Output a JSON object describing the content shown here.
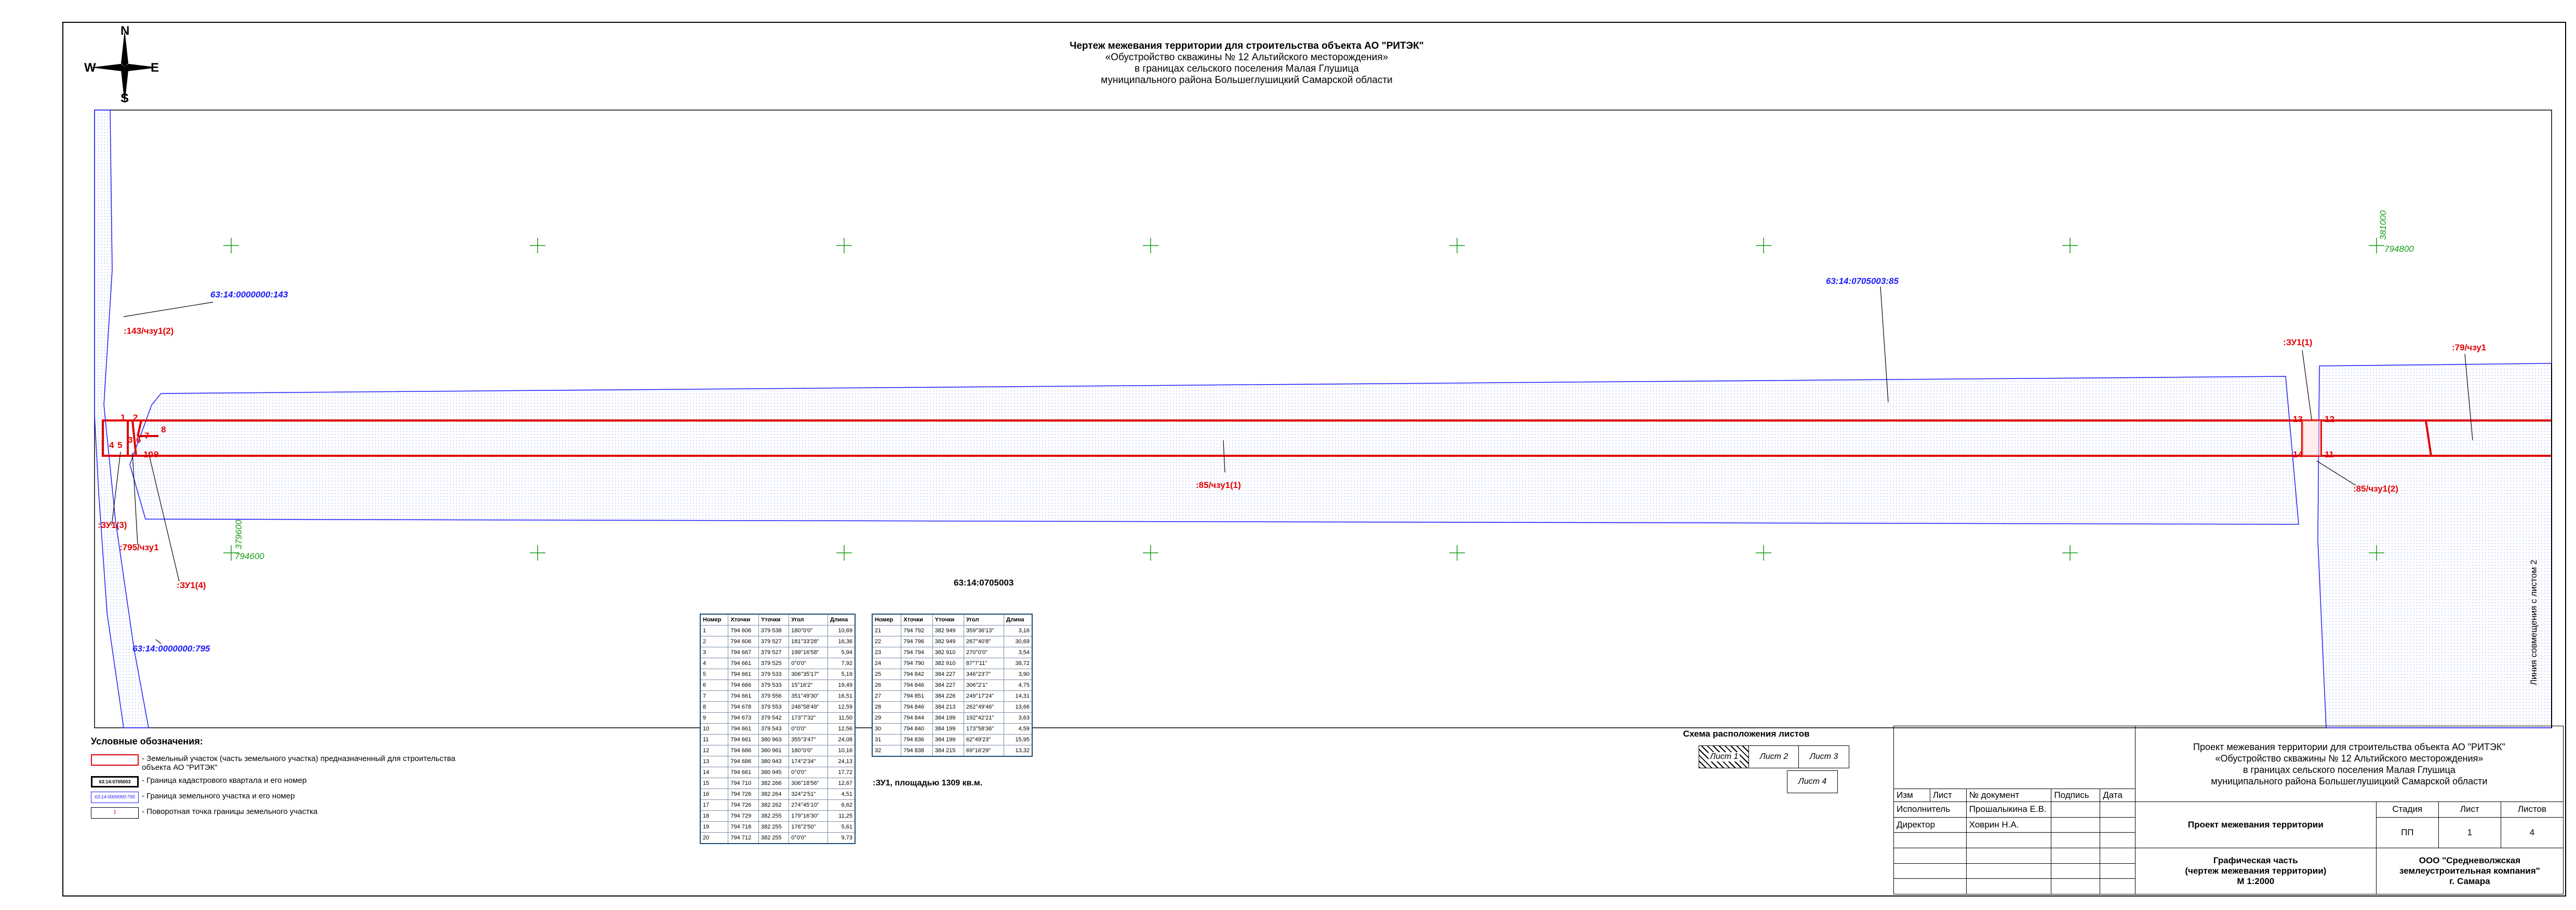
{
  "title": {
    "line1": "Чертеж межевания территории для строительства объекта АО \"РИТЭК\"",
    "line2": "«Обустройство скважины № 12 Альтийского месторождения»",
    "line3": "в границах сельского поселения Малая Глушица",
    "line4": "муниципального района Большеглушицкий Самарской области"
  },
  "compass": {
    "n": "N",
    "s": "S",
    "w": "W",
    "e": "E"
  },
  "map_labels": {
    "cad143": "63:14:0000000:143",
    "cad795": "63:14:0000000:795",
    "cad85": "63:14:0705003:85",
    "quarter": "63:14:0705003",
    "part143": ":143/чзу1(2)",
    "part795": ":795/чзу1",
    "zu1_1": ":ЗУ1(1)",
    "zu1_3": ":ЗУ1(3)",
    "zu1_4": ":ЗУ1(4)",
    "part85_1": ":85/чзу1(1)",
    "part85_2": ":85/чзу1(2)",
    "part79": ":79/чзу1",
    "grid_x1": "381000",
    "grid_y1": "794800",
    "grid_x2": "379600",
    "grid_y2": "794600",
    "combine_line": "Линия совмещения с листом 2",
    "area_note": ":ЗУ1, площадью 1309 кв.м."
  },
  "nodes": [
    "1",
    "2",
    "3",
    "4",
    "5",
    "6",
    "7",
    "8",
    "9",
    "10",
    "12",
    "13",
    "14",
    "11"
  ],
  "coord_table_headers": [
    "Номер",
    "Xточки",
    "Yточки",
    "Угол",
    "Длина"
  ],
  "coord_table_1": [
    [
      "1",
      "794 606",
      "379 538",
      "180°0'0\"",
      "10,69"
    ],
    [
      "2",
      "794 606",
      "379 527",
      "181°33'28\"",
      "16,36"
    ],
    [
      "3",
      "794 667",
      "379 527",
      "199°16'58\"",
      "5,94"
    ],
    [
      "4",
      "794 661",
      "379 525",
      "0°0'0\"",
      "7,92"
    ],
    [
      "5",
      "794 661",
      "379 533",
      "306°35'17\"",
      "5,19"
    ],
    [
      "6",
      "794 666",
      "379 533",
      "15°16'2\"",
      "19,49"
    ],
    [
      "7",
      "794 661",
      "379 556",
      "351°49'30\"",
      "16,51"
    ],
    [
      "8",
      "794 678",
      "379 553",
      "246°58'49\"",
      "12,59"
    ],
    [
      "9",
      "794 673",
      "379 542",
      "173°7'32\"",
      "11,50"
    ],
    [
      "10",
      "794 661",
      "379 543",
      "0°0'0\"",
      "12,56"
    ],
    [
      "11",
      "794 661",
      "380 963",
      "355°3'47\"",
      "24,08"
    ],
    [
      "12",
      "794 686",
      "380 961",
      "180°0'0\"",
      "10,16"
    ],
    [
      "13",
      "794 686",
      "380 943",
      "174°2'34\"",
      "24,13"
    ],
    [
      "14",
      "794 661",
      "380 945",
      "0°0'0\"",
      "17,72"
    ],
    [
      "15",
      "794 710",
      "382 266",
      "306°18'56\"",
      "12,67"
    ],
    [
      "16",
      "794 726",
      "382 264",
      "324°2'51\"",
      "4,51"
    ],
    [
      "17",
      "794 726",
      "382 262",
      "274°45'10\"",
      "6,62"
    ],
    [
      "18",
      "794 729",
      "382 255",
      "179°16'30\"",
      "11,25"
    ],
    [
      "19",
      "794 718",
      "382 255",
      "176°2'50\"",
      "5,61"
    ],
    [
      "20",
      "794 712",
      "382 255",
      "0°0'0\"",
      "9,73"
    ]
  ],
  "coord_table_2": [
    [
      "21",
      "794 792",
      "382 949",
      "359°36'13\"",
      "3,16"
    ],
    [
      "22",
      "794 796",
      "382 949",
      "267°40'8\"",
      "30,69"
    ],
    [
      "23",
      "794 794",
      "382 910",
      "270°0'0\"",
      "3,54"
    ],
    [
      "24",
      "794 790",
      "382 910",
      "87°7'11\"",
      "38,72"
    ],
    [
      "25",
      "794 842",
      "384 227",
      "346°23'7\"",
      "3,90"
    ],
    [
      "26",
      "794 846",
      "384 227",
      "306°2'1\"",
      "4,75"
    ],
    [
      "27",
      "794 851",
      "384 226",
      "249°17'24\"",
      "14,31"
    ],
    [
      "28",
      "794 846",
      "384 213",
      "262°49'46\"",
      "13,66"
    ],
    [
      "29",
      "794 844",
      "384 199",
      "192°42'21\"",
      "3,63"
    ],
    [
      "30",
      "794 840",
      "384 199",
      "173°58'36\"",
      "4,59"
    ],
    [
      "31",
      "794 836",
      "384 199",
      "62°49'23\"",
      "15,95"
    ],
    [
      "32",
      "794 838",
      "384 215",
      "69°16'29\"",
      "13,32"
    ]
  ],
  "legend": {
    "heading": "Условные обозначения:",
    "item1": "- Земельный участок (часть земельного участка) предназначенный для строительства объекта АО \"РИТЭК\"",
    "item2": "- Граница кадастрового квартала и его номер",
    "item3": "- Граница земельного участка и его номер",
    "item4": "- Поворотная точка границы земельного участка",
    "sym2_text": "63:14:0705003",
    "sym3_text": "63:14:0000000:795",
    "sym4_text": "1"
  },
  "sheet_scheme": {
    "title": "Схема расположения листов",
    "s1": "Лист 1",
    "s2": "Лист 2",
    "s3": "Лист 3",
    "s4": "Лист 4"
  },
  "stamp": {
    "h_izm": "Изм",
    "h_list": "Лист",
    "h_doc": "№ документ",
    "h_sign": "Подпись",
    "h_date": "Дата",
    "role1": "Исполнитель",
    "name1": "Прошалыкина Е.В.",
    "role2": "Директор",
    "name2": "Ховрин Н.А.",
    "project1": "Проект межевания территории для строительства объекта АО \"РИТЭК\"",
    "project2": "«Обустройство скважины № 12 Альтийского месторождения»",
    "project3": "в границах сельского поселения Малая Глушица",
    "project4": "муниципального района Большеглушицкий Самарской области",
    "section": "Проект межевания территории",
    "h_stage": "Стадия",
    "h_sheet": "Лист",
    "h_sheets": "Листов",
    "stage": "ПП",
    "sheet": "1",
    "sheets": "4",
    "drawing1": "Графическая часть",
    "drawing2": "(чертеж межевания территории)",
    "drawing3": "М 1:2000",
    "org1": "ООО \"Средневолжская",
    "org2": "землеустроительная компания\"",
    "org3": "г. Самара"
  },
  "colors": {
    "plot_border": "#e00000",
    "cad_border": "#1a1aff",
    "grid": "#169c16",
    "hatch": "#b8c4ff"
  }
}
